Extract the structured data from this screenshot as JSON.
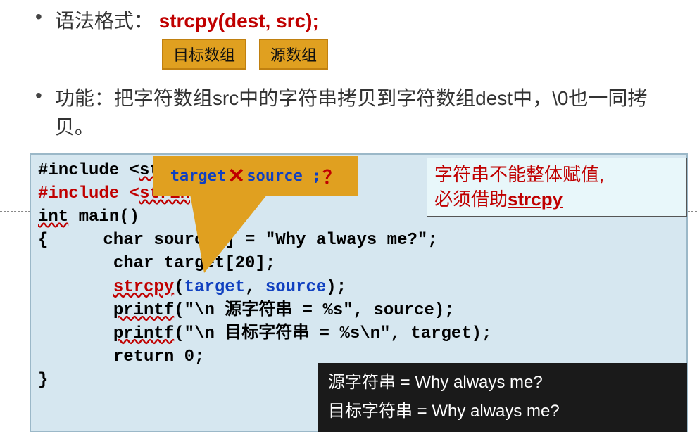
{
  "bullet1_label": "语法格式：",
  "syntax_call": "strcpy(dest, src);",
  "tag_dest": "目标数组",
  "tag_src": "源数组",
  "bullet2_label": "功能：",
  "bullet2_text": "把字符数组src中的字符串拷贝到字符数组dest中，\\0也一同拷贝。",
  "callout_target": "target",
  "callout_source": "source ;",
  "callout_question": "？",
  "note_line1_a": "字符串不能整体赋值,",
  "note_line2_a": "必须借助",
  "note_line2_b": "strcpy",
  "code": {
    "l1a": "#include <",
    "l1b": "stdio",
    "l2a": "#include <",
    "l2b": "strin",
    "l3a": "int",
    "l3b": " main()",
    "l4": "{",
    "l4b": "char source",
    "l4c": "  ] = \"Why always me?\";",
    "l5": "char target[20];",
    "l6a": "strcpy",
    "l6b": "(",
    "l6c": "target",
    "l6d": ", ",
    "l6e": "source",
    "l6f": ");",
    "l7a": "printf",
    "l7b": "(\"\\n 源字符串 = %s\", source);",
    "l8a": "printf",
    "l8b": "(\"\\n 目标字符串 = %s\\n\", target);",
    "l9": "return 0;",
    "l10": "}"
  },
  "output": {
    "l1": "源字符串 = Why always me?",
    "l2": "目标字符串 = Why always me?"
  }
}
